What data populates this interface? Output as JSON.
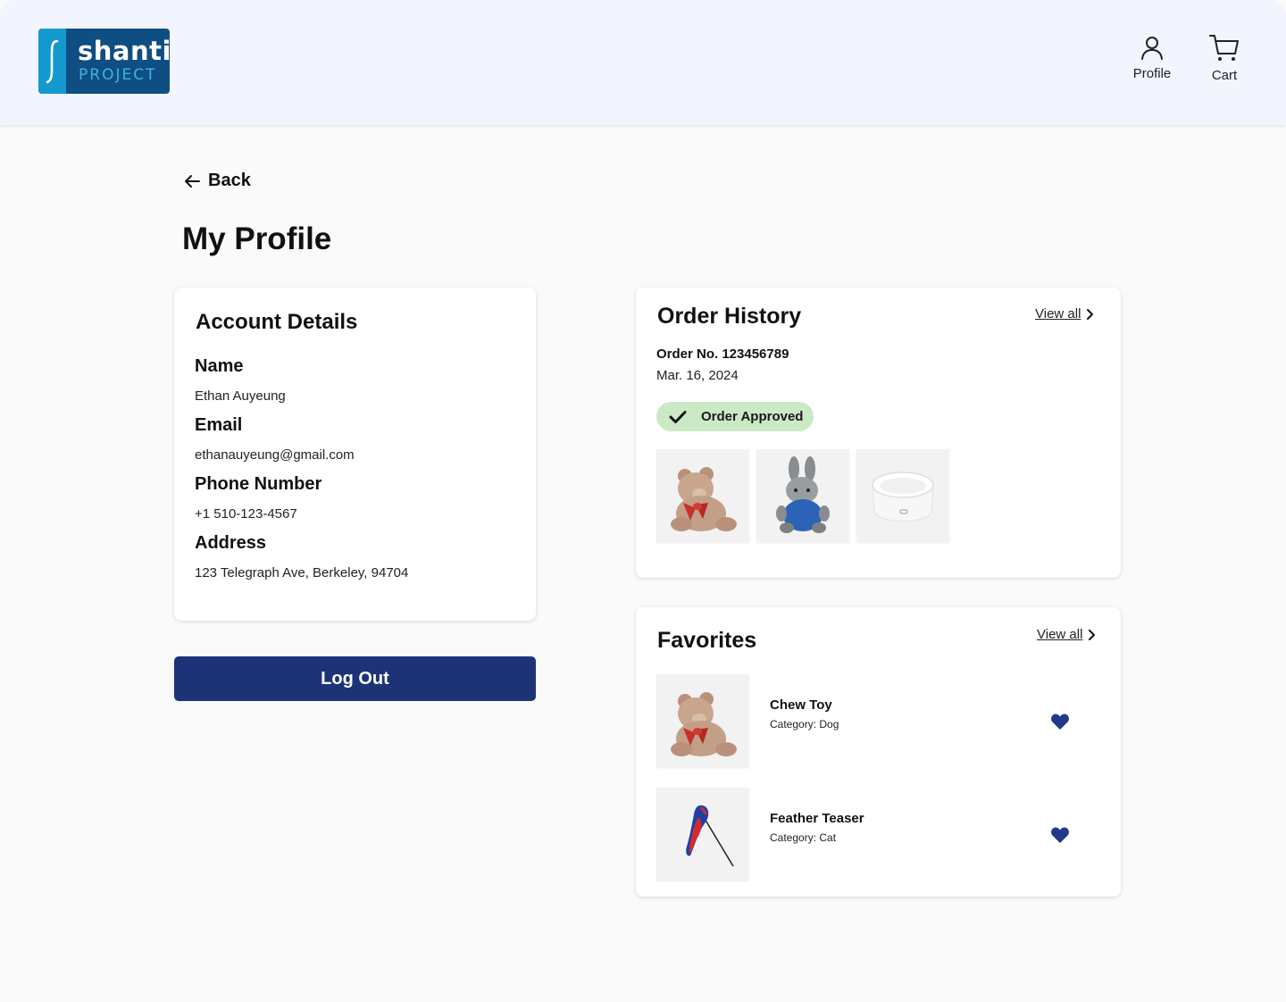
{
  "header": {
    "logo": {
      "word1": "shanti",
      "word2": "PROJECT"
    },
    "nav": [
      {
        "label": "Profile",
        "icon": "user-icon"
      },
      {
        "label": "Cart",
        "icon": "cart-icon"
      }
    ]
  },
  "back_label": "Back",
  "page_title": "My Profile",
  "account": {
    "title": "Account Details",
    "fields": [
      {
        "label": "Name",
        "value": "Ethan Auyeung"
      },
      {
        "label": "Email",
        "value": "ethanauyeung@gmail.com"
      },
      {
        "label": "Phone Number",
        "value": "+1 510-123-4567"
      },
      {
        "label": "Address",
        "value": "123 Telegraph Ave, Berkeley, 94704"
      }
    ]
  },
  "logout_label": "Log Out",
  "orders": {
    "title": "Order History",
    "view_all": "View all",
    "order_no": "Order No. 123456789",
    "date": "Mar. 16, 2024",
    "status": "Order Approved",
    "status_color": "#cce9c6",
    "items": [
      "teddy-bear-image",
      "plush-bunny-image",
      "pet-bowl-image"
    ]
  },
  "favorites": {
    "title": "Favorites",
    "view_all": "View all",
    "items": [
      {
        "name": "Chew Toy",
        "category": "Category: Dog",
        "image": "teddy-bear-image"
      },
      {
        "name": "Feather Teaser",
        "category": "Category: Cat",
        "image": "feather-teaser-image"
      }
    ]
  },
  "colors": {
    "header_bg": "#f2f5fd",
    "primary": "#1d3378",
    "heart": "#22388a",
    "logo_dark": "#0f4e82",
    "logo_light": "#1499cf"
  }
}
